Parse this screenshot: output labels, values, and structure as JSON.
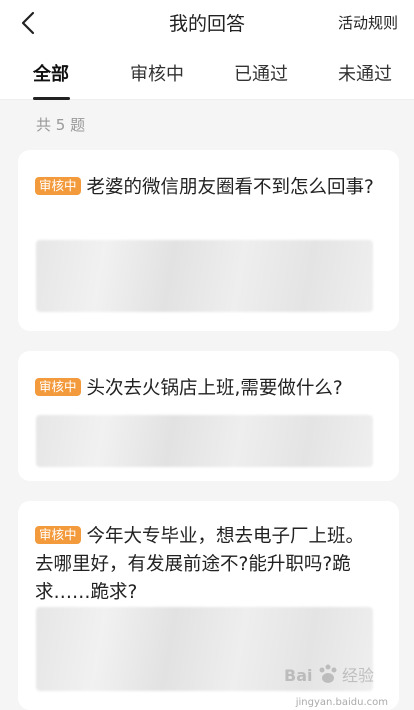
{
  "header": {
    "title": "我的回答",
    "rules_label": "活动规则"
  },
  "tabs": [
    {
      "label": "全部",
      "active": true
    },
    {
      "label": "审核中",
      "active": false
    },
    {
      "label": "已通过",
      "active": false
    },
    {
      "label": "未通过",
      "active": false
    }
  ],
  "summary": {
    "count_text": "共 5 题"
  },
  "questions": [
    {
      "status": "审核中",
      "title": "老婆的微信朋友圈看不到怎么回事?"
    },
    {
      "status": "审核中",
      "title": "头次去火锅店上班,需要做什么?"
    },
    {
      "status": "审核中",
      "title": "今年大专毕业，想去电子厂上班。去哪里好，有发展前途不?能升职吗?跪求……跪求?"
    }
  ],
  "watermark": {
    "text": "Bai 经验",
    "domain": "jingyan.baidu.com"
  },
  "colors": {
    "badge": "#f39a3c",
    "background": "#f5f5f5",
    "card": "#ffffff"
  }
}
